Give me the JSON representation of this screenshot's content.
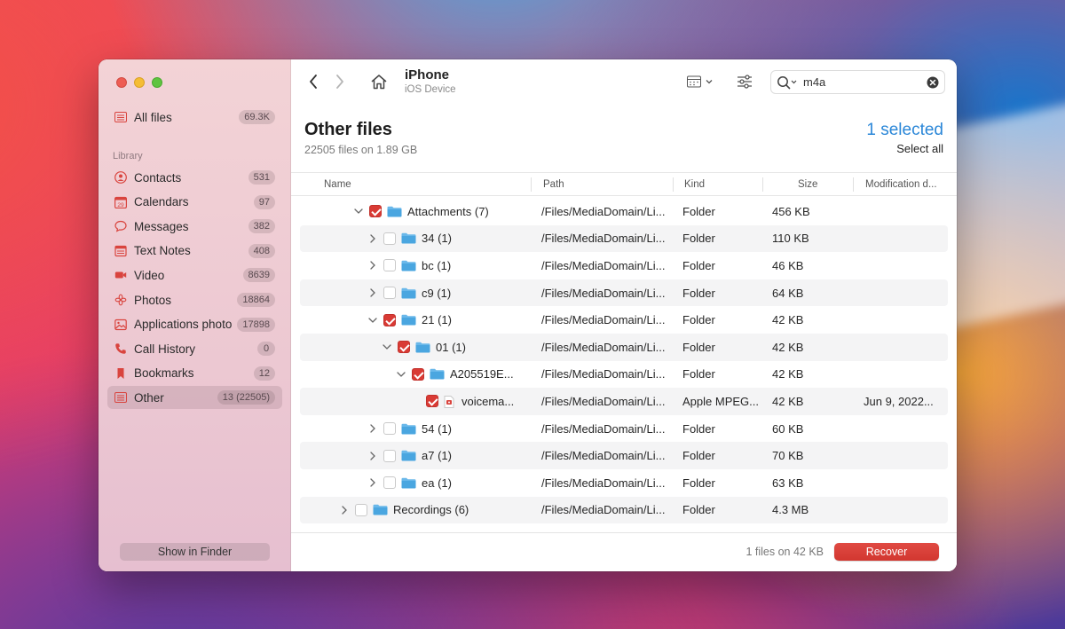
{
  "sidebar": {
    "all_files": {
      "label": "All files",
      "count": "69.3K"
    },
    "section": "Library",
    "items": [
      {
        "label": "Contacts",
        "count": "531",
        "icon": "contacts-icon"
      },
      {
        "label": "Calendars",
        "count": "97",
        "icon": "calendar-icon"
      },
      {
        "label": "Messages",
        "count": "382",
        "icon": "messages-icon"
      },
      {
        "label": "Text Notes",
        "count": "408",
        "icon": "notes-icon"
      },
      {
        "label": "Video",
        "count": "8639",
        "icon": "video-icon"
      },
      {
        "label": "Photos",
        "count": "18864",
        "icon": "photos-icon"
      },
      {
        "label": "Applications photo",
        "count": "17898",
        "icon": "app-photo-icon"
      },
      {
        "label": "Call History",
        "count": "0",
        "icon": "phone-icon"
      },
      {
        "label": "Bookmarks",
        "count": "12",
        "icon": "bookmark-icon"
      },
      {
        "label": "Other",
        "count": "13 (22505)",
        "icon": "other-icon",
        "active": true
      }
    ],
    "finder_button": "Show in Finder"
  },
  "toolbar": {
    "device_title": "iPhone",
    "device_subtitle": "iOS Device",
    "search_value": "m4a"
  },
  "header": {
    "title": "Other files",
    "subtitle": "22505 files on 1.89 GB",
    "selected": "1 selected",
    "select_all": "Select all"
  },
  "columns": {
    "name": "Name",
    "path": "Path",
    "kind": "Kind",
    "size": "Size",
    "modified": "Modification d..."
  },
  "rows": [
    {
      "level": 0,
      "expanded": true,
      "checked": true,
      "type": "folder",
      "name": "Attachments (7)",
      "path": "/Files/MediaDomain/Li...",
      "kind": "Folder",
      "size": "456 KB",
      "date": ""
    },
    {
      "level": 1,
      "expanded": false,
      "checked": false,
      "type": "folder",
      "name": "34 (1)",
      "path": "/Files/MediaDomain/Li...",
      "kind": "Folder",
      "size": "110 KB",
      "date": ""
    },
    {
      "level": 1,
      "expanded": false,
      "checked": false,
      "type": "folder",
      "name": "bc (1)",
      "path": "/Files/MediaDomain/Li...",
      "kind": "Folder",
      "size": "46 KB",
      "date": ""
    },
    {
      "level": 1,
      "expanded": false,
      "checked": false,
      "type": "folder",
      "name": "c9 (1)",
      "path": "/Files/MediaDomain/Li...",
      "kind": "Folder",
      "size": "64 KB",
      "date": ""
    },
    {
      "level": 1,
      "expanded": true,
      "checked": true,
      "type": "folder",
      "name": "21 (1)",
      "path": "/Files/MediaDomain/Li...",
      "kind": "Folder",
      "size": "42 KB",
      "date": ""
    },
    {
      "level": 2,
      "expanded": true,
      "checked": true,
      "type": "folder",
      "name": "01 (1)",
      "path": "/Files/MediaDomain/Li...",
      "kind": "Folder",
      "size": "42 KB",
      "date": ""
    },
    {
      "level": 3,
      "expanded": true,
      "checked": true,
      "type": "folder",
      "name": "A205519E...",
      "path": "/Files/MediaDomain/Li...",
      "kind": "Folder",
      "size": "42 KB",
      "date": ""
    },
    {
      "level": 4,
      "expanded": null,
      "checked": true,
      "type": "file",
      "name": "voicema...",
      "path": "/Files/MediaDomain/Li...",
      "kind": "Apple MPEG...",
      "size": "42 KB",
      "date": "Jun 9, 2022..."
    },
    {
      "level": 1,
      "expanded": false,
      "checked": false,
      "type": "folder",
      "name": "54 (1)",
      "path": "/Files/MediaDomain/Li...",
      "kind": "Folder",
      "size": "60 KB",
      "date": ""
    },
    {
      "level": 1,
      "expanded": false,
      "checked": false,
      "type": "folder",
      "name": "a7 (1)",
      "path": "/Files/MediaDomain/Li...",
      "kind": "Folder",
      "size": "70 KB",
      "date": ""
    },
    {
      "level": 1,
      "expanded": false,
      "checked": false,
      "type": "folder",
      "name": "ea (1)",
      "path": "/Files/MediaDomain/Li...",
      "kind": "Folder",
      "size": "63 KB",
      "date": ""
    },
    {
      "level": -1,
      "expanded": false,
      "checked": false,
      "type": "folder",
      "name": "Recordings (6)",
      "path": "/Files/MediaDomain/Li...",
      "kind": "Folder",
      "size": "4.3 MB",
      "date": ""
    }
  ],
  "footer": {
    "info": "1 files on 42 KB",
    "recover": "Recover"
  },
  "colors": {
    "accent_red": "#d93b35",
    "selection_blue": "#2b87d8",
    "folder_blue": "#4aa6e0"
  }
}
